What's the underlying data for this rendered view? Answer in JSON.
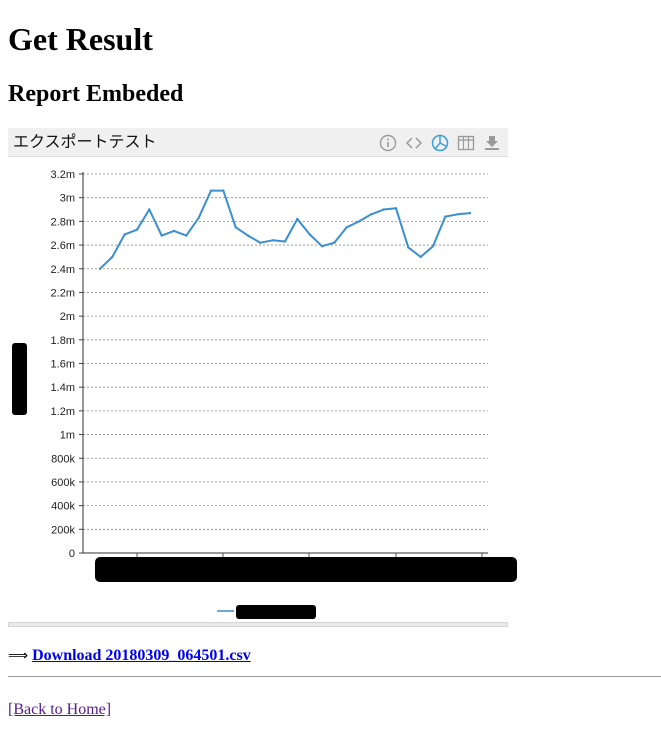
{
  "page": {
    "title": "Get Result",
    "subtitle": "Report Embeded"
  },
  "widget": {
    "title": "エクスポートテスト",
    "toolbar": [
      "info-icon",
      "code-icon",
      "chart-pie-icon",
      "table-icon",
      "download-icon"
    ],
    "active_tool": "chart-pie-icon"
  },
  "chart_data": {
    "type": "line",
    "title": "",
    "xlabel": "",
    "ylabel": "",
    "ylim": [
      0,
      3200000
    ],
    "y_ticks": [
      "0",
      "200k",
      "400k",
      "600k",
      "800k",
      "1m",
      "1.2m",
      "1.4m",
      "1.6m",
      "1.8m",
      "2m",
      "2.2m",
      "2.4m",
      "2.6m",
      "2.8m",
      "3m",
      "3.2m"
    ],
    "grid": true,
    "legend_position": "bottom",
    "series": [
      {
        "color": "#3a8fcf",
        "values": [
          2400000,
          2500000,
          2690000,
          2730000,
          2900000,
          2680000,
          2720000,
          2680000,
          2830000,
          3060000,
          3060000,
          2750000,
          2680000,
          2620000,
          2640000,
          2630000,
          2820000,
          2690000,
          2590000,
          2620000,
          2750000,
          2800000,
          2860000,
          2900000,
          2910000,
          2580000,
          2500000,
          2590000,
          2840000,
          2860000,
          2870000
        ]
      }
    ]
  },
  "links": {
    "arrow": "⟹",
    "download_label": "Download 20180309_064501.csv",
    "back_label": "[Back to Home]"
  }
}
